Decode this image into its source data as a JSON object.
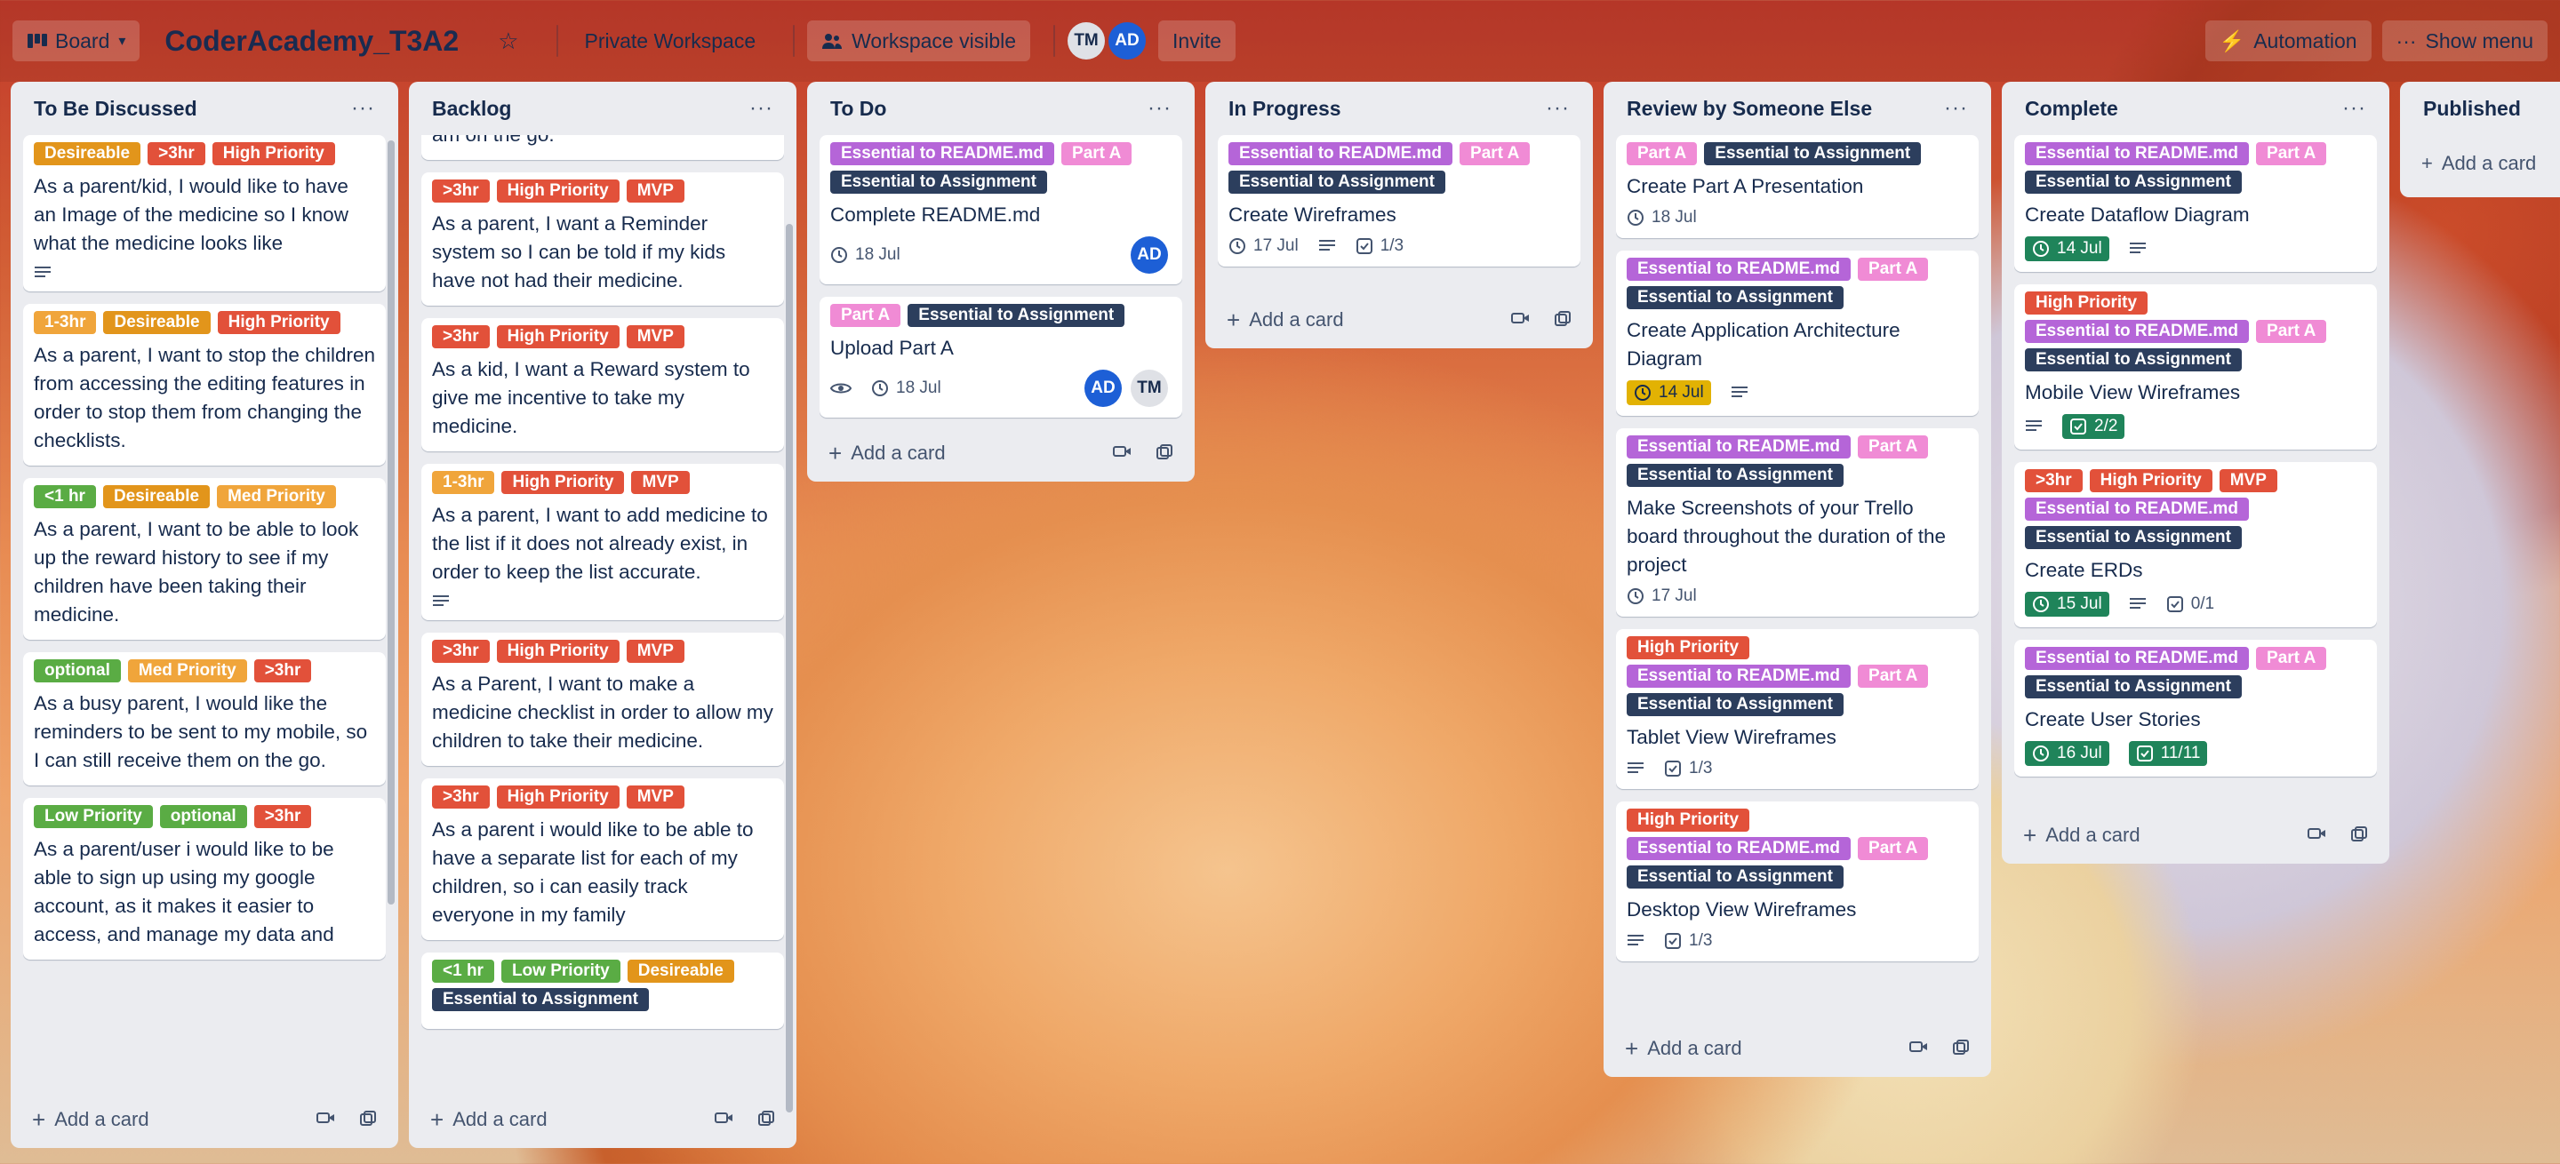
{
  "topbar": {
    "view_label": "Board",
    "board_title": "CoderAcademy_T3A2",
    "workspace": "Private Workspace",
    "visibility": "Workspace visible",
    "members": [
      "TM",
      "AD"
    ],
    "invite": "Invite",
    "automation": "Automation",
    "show_menu": "Show menu"
  },
  "colors": {
    "Desireable": "#e2951b",
    "High Priority": "#e2513a",
    "Med Priority": "#f0a53b",
    "MVP": "#e2513a",
    "Low Priority": "#5aac44",
    "optional": "#5aac44",
    "Essential to README.md": "#b565d8",
    "Part A": "#f08bd5",
    "Essential to Assignment": "#2c3e5d",
    ">3hr": "#e2513a",
    "1-3hr": "#f0a53b",
    "<1 hr": "#5aac44"
  },
  "add_card": "Add a card",
  "lists": [
    {
      "title": "To Be Discussed",
      "cards": [
        {
          "labels": [
            "Desireable",
            ">3hr",
            "High Priority"
          ],
          "title": "As a parent/kid, I would like to have an Image of the medicine so I know what the medicine looks like",
          "desc": true
        },
        {
          "labels": [
            "1-3hr",
            "Desireable",
            "High Priority"
          ],
          "title": "As a parent, I want to stop the children from accessing the editing features in order to stop them from changing the checklists."
        },
        {
          "labels": [
            "<1 hr",
            "Desireable",
            "Med Priority"
          ],
          "title": "As a parent, I want to be able to look up the reward history to see if my children have been taking their medicine."
        },
        {
          "labels": [
            "optional",
            "Med Priority",
            ">3hr"
          ],
          "title": "As a busy parent, I would like the reminders to be sent to my mobile, so I can still receive them on the go."
        },
        {
          "labels": [
            "Low Priority",
            "optional",
            ">3hr"
          ],
          "title": "As a parent/user i would like to be able to sign up using my google account, as it makes it easier to access, and manage my data and"
        }
      ]
    },
    {
      "title": "Backlog",
      "cards": [
        {
          "labels": [],
          "title": "am on the go."
        },
        {
          "labels": [
            ">3hr",
            "High Priority",
            "MVP"
          ],
          "title": "As a parent, I want a Reminder system so I can be told if my kids have not had their medicine."
        },
        {
          "labels": [
            ">3hr",
            "High Priority",
            "MVP"
          ],
          "title": "As a kid, I want a Reward system to give me incentive to take my medicine."
        },
        {
          "labels": [
            "1-3hr",
            "High Priority",
            "MVP"
          ],
          "title": "As a parent, I want to add medicine to the list if it does not already exist, in order to keep the list accurate.",
          "desc": true
        },
        {
          "labels": [
            ">3hr",
            "High Priority",
            "MVP"
          ],
          "title": "As a Parent, I want to make a medicine checklist in order to allow my children to take their medicine."
        },
        {
          "labels": [
            ">3hr",
            "High Priority",
            "MVP"
          ],
          "title": "As a parent i would like to be able to have a separate list for each of my children, so i can easily track everyone in my family"
        },
        {
          "labels": [
            "<1 hr",
            "Low Priority",
            "Desireable",
            "Essential to Assignment"
          ],
          "title": ""
        }
      ]
    },
    {
      "title": "To Do",
      "cards": [
        {
          "labels": [
            "Essential to README.md",
            "Part A",
            "Essential to Assignment"
          ],
          "title": "Complete README.md",
          "due": "18 Jul",
          "members": [
            "AD"
          ]
        },
        {
          "labels": [
            "Part A",
            "Essential to Assignment"
          ],
          "title": "Upload Part A",
          "watch": true,
          "due": "18 Jul",
          "members": [
            "AD",
            "TM"
          ]
        }
      ]
    },
    {
      "title": "In Progress",
      "cards": [
        {
          "labels": [
            "Essential to README.md",
            "Part A",
            "Essential to Assignment"
          ],
          "title": "Create Wireframes",
          "due": "17 Jul",
          "desc": true,
          "checklist": "1/3"
        }
      ]
    },
    {
      "title": "Review by Someone Else",
      "cards": [
        {
          "labels": [
            "Part A",
            "Essential to Assignment"
          ],
          "title": "Create Part A Presentation",
          "due": "18 Jul"
        },
        {
          "labels": [
            "Essential to README.md",
            "Part A",
            "Essential to Assignment"
          ],
          "title": "Create Application Architecture Diagram",
          "due": "14 Jul",
          "due_style": "yellow",
          "desc": true
        },
        {
          "labels": [
            "Essential to README.md",
            "Part A",
            "Essential to Assignment"
          ],
          "title": "Make Screenshots of your Trello board throughout the duration of the project",
          "due": "17 Jul"
        },
        {
          "labels": [
            "High Priority",
            "Essential to README.md",
            "Part A",
            "Essential to Assignment"
          ],
          "title": "Tablet View Wireframes",
          "desc": true,
          "checklist": "1/3"
        },
        {
          "labels": [
            "High Priority",
            "Essential to README.md",
            "Part A",
            "Essential to Assignment"
          ],
          "title": "Desktop View Wireframes",
          "desc": true,
          "checklist": "1/3"
        }
      ]
    },
    {
      "title": "Complete",
      "cards": [
        {
          "labels": [
            "Essential to README.md",
            "Part A",
            "Essential to Assignment"
          ],
          "title": "Create Dataflow Diagram",
          "due": "14 Jul",
          "due_style": "green",
          "desc": true
        },
        {
          "labels": [
            "High Priority",
            "Essential to README.md",
            "Part A",
            "Essential to Assignment"
          ],
          "title": "Mobile View Wireframes",
          "desc": true,
          "checklist": "2/2",
          "checklist_style": "green"
        },
        {
          "labels": [
            ">3hr",
            "High Priority",
            "MVP",
            "Essential to README.md",
            "Essential to Assignment"
          ],
          "title": "Create ERDs",
          "due": "15 Jul",
          "due_style": "green",
          "desc": true,
          "checklist": "0/1"
        },
        {
          "labels": [
            "Essential to README.md",
            "Part A",
            "Essential to Assignment"
          ],
          "title": "Create User Stories",
          "due": "16 Jul",
          "due_style": "green",
          "checklist": "11/11",
          "checklist_style": "green"
        }
      ]
    },
    {
      "title": "Published",
      "cards": []
    }
  ]
}
